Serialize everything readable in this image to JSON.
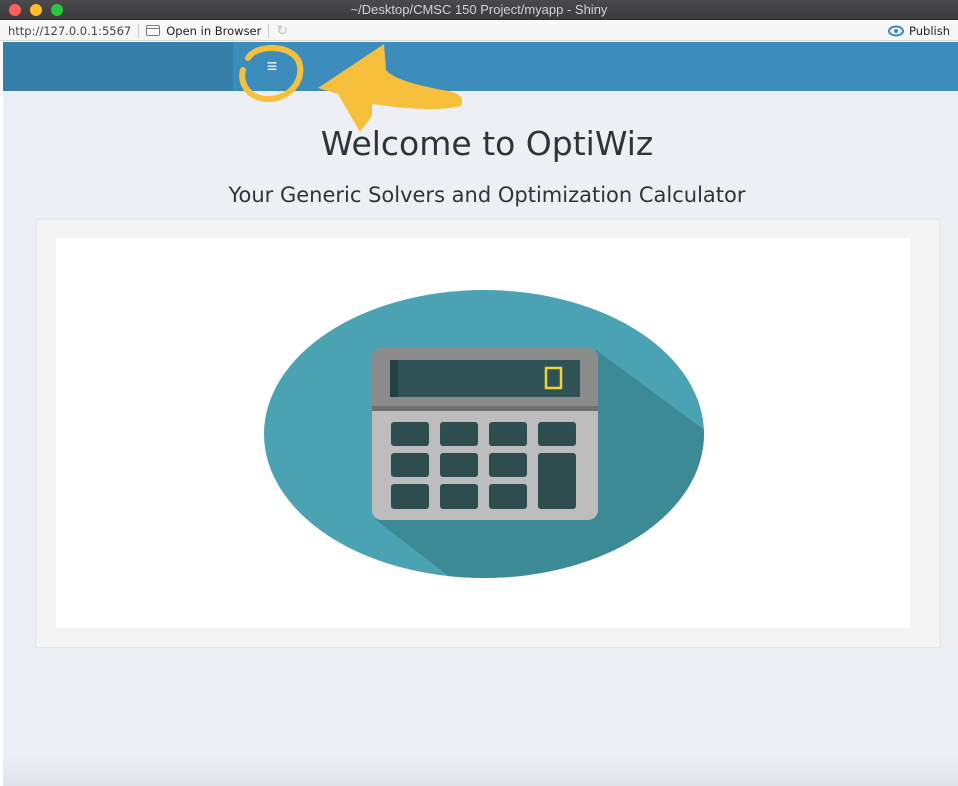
{
  "window": {
    "title": "~/Desktop/CMSC 150 Project/myapp - Shiny"
  },
  "toolbar": {
    "url": "http://127.0.0.1:5567",
    "open_in_browser_label": "Open in Browser",
    "publish_label": "Publish"
  },
  "header": {
    "toggle_icon": "hamburger-menu-icon",
    "toggle_glyph": "≡"
  },
  "main": {
    "title": "Welcome to OptiWiz",
    "subtitle": "Your Generic Solvers and Optimization Calculator",
    "image_icon": "calculator-icon"
  },
  "colors": {
    "header": "#3c8dbc",
    "content_bg": "#ecf0f5",
    "annotation": "#f6c03c",
    "ellipse": "#4aa0b0",
    "calc_body": "#bdbdbd",
    "calc_keys": "#2e4d4f"
  }
}
